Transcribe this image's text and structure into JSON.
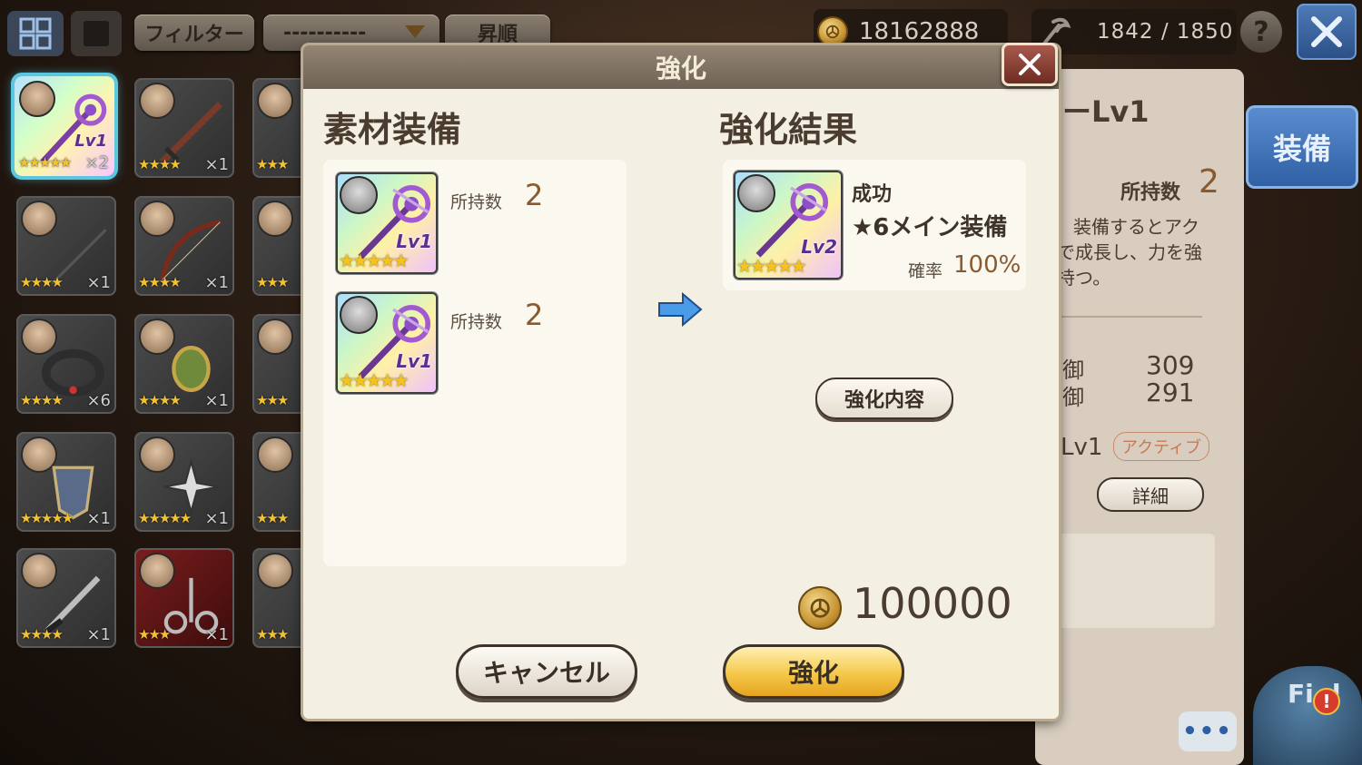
{
  "topbar": {
    "filter_label": "フィルター",
    "sort_select_value": "----------",
    "order_label": "昇順",
    "gold_amount": "18162888",
    "capacity": "1842 / 1850",
    "help_label": "?"
  },
  "inventory": [
    {
      "stars": "★★★★★",
      "count": "×2",
      "lv": "Lv1",
      "style": "rainbow",
      "selected": true
    },
    {
      "stars": "★★★★",
      "count": "×1",
      "style": "dark"
    },
    {
      "stars": "★★★",
      "count": "",
      "style": "dark"
    },
    {
      "stars": "★★★★",
      "count": "×1",
      "style": "dark"
    },
    {
      "stars": "★★★★",
      "count": "×1",
      "style": "dark"
    },
    {
      "stars": "★★★",
      "count": "",
      "style": "dark"
    },
    {
      "stars": "★★★★",
      "count": "×6",
      "style": "dark"
    },
    {
      "stars": "★★★★",
      "count": "×1",
      "style": "dark"
    },
    {
      "stars": "★★★",
      "count": "",
      "style": "dark"
    },
    {
      "stars": "★★★★★",
      "count": "×1",
      "style": "dark"
    },
    {
      "stars": "★★★★★",
      "count": "×1",
      "style": "dark"
    },
    {
      "stars": "★★★",
      "count": "",
      "style": "dark"
    },
    {
      "stars": "★★★★",
      "count": "×1",
      "style": "dark"
    },
    {
      "stars": "★★★",
      "count": "×1",
      "style": "red"
    },
    {
      "stars": "★★★",
      "count": "",
      "style": "dark"
    }
  ],
  "side_panel": {
    "name_suffix": "ーLv1",
    "own_label": "所持数",
    "own_value": "2",
    "desc_line1": "装備するとアク",
    "desc_line2": "で成長し、力を強",
    "desc_line3": "持つ。",
    "stat1_label": "御",
    "stat1_value": "309",
    "stat2_label": "御",
    "stat2_value": "291",
    "skill_lv": "Lv1",
    "skill_tag": "アクティブ",
    "detail_button": "詳細",
    "equip_button": "装備"
  },
  "modal": {
    "title": "強化",
    "material_title": "素材装備",
    "result_title": "強化結果",
    "materials": [
      {
        "own_label": "所持数",
        "own_value": "2",
        "lv": "Lv1",
        "stars": "★★★★★"
      },
      {
        "own_label": "所持数",
        "own_value": "2",
        "lv": "Lv1",
        "stars": "★★★★★"
      }
    ],
    "result": {
      "status": "成功",
      "name": "★6メイン装備",
      "rate_label": "確率",
      "rate_value": "100%",
      "lv": "Lv2",
      "stars": "★★★★★"
    },
    "detail_button": "強化内容",
    "cost": "100000",
    "cancel_button": "キャンセル",
    "enhance_button": "強化"
  },
  "bottom": {
    "chat_label": "•••",
    "mascot_text": "Fi d",
    "alert": "!"
  },
  "colors": {
    "accent_blue": "#2f5ea3",
    "enhance_gold": "#f5c84a",
    "value_brown": "#8a5a2e"
  }
}
